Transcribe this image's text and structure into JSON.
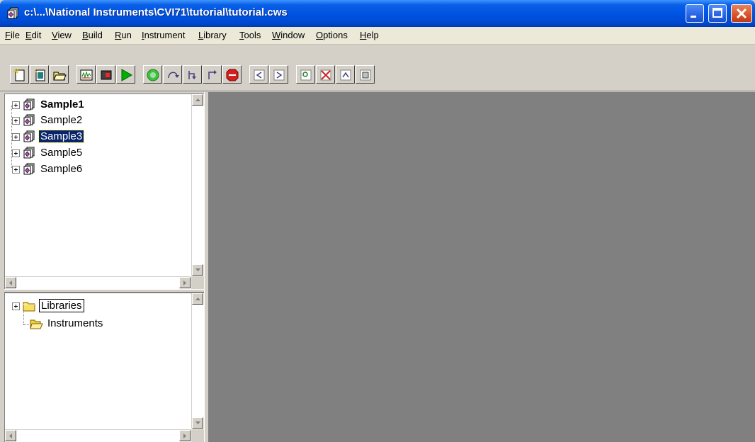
{
  "window": {
    "title": "c:\\...\\National Instruments\\CVI71\\tutorial\\tutorial.cws"
  },
  "menu": [
    {
      "label": "File",
      "u": "F",
      "rest": "ile"
    },
    {
      "label": "Edit",
      "u": "E",
      "rest": "dit"
    },
    {
      "label": "View",
      "u": "V",
      "rest": "iew"
    },
    {
      "label": "Build",
      "u": "B",
      "rest": "uild"
    },
    {
      "label": "Run",
      "u": "R",
      "rest": "un"
    },
    {
      "label": "Instrument",
      "u": "I",
      "rest": "nstrument"
    },
    {
      "label": "Library",
      "u": "L",
      "rest": "ibrary"
    },
    {
      "label": "Tools",
      "u": "T",
      "rest": "ools"
    },
    {
      "label": "Window",
      "u": "W",
      "rest": "indow"
    },
    {
      "label": "Options",
      "u": "O",
      "rest": "ptions"
    },
    {
      "label": "Help",
      "u": "H",
      "rest": "elp"
    }
  ],
  "toolbar": {
    "buttons": [
      "new-file-icon",
      "new-project-icon",
      "open-icon",
      "uir-editor-icon",
      "panel-icon",
      "run-icon",
      "go-icon",
      "step-over-icon",
      "step-into-icon",
      "finish-function-icon",
      "stop-icon",
      "breakpoint-prev-icon",
      "breakpoint-next-icon",
      "find-icon",
      "toggle-breakpoint-icon",
      "watch-icon",
      "tag-icon"
    ]
  },
  "project_tree": {
    "items": [
      {
        "label": "Sample1",
        "state": "bold"
      },
      {
        "label": "Sample2",
        "state": "normal"
      },
      {
        "label": "Sample3",
        "state": "selected"
      },
      {
        "label": "Sample5",
        "state": "normal"
      },
      {
        "label": "Sample6",
        "state": "normal"
      }
    ]
  },
  "library_tree": {
    "items": [
      {
        "label": "Libraries",
        "expandable": true,
        "focused": true
      },
      {
        "label": "Instruments",
        "expandable": false,
        "focused": false
      }
    ]
  },
  "colors": {
    "titlebar": "#0054e3",
    "workspace": "#808080",
    "selection": "#0a246a"
  }
}
